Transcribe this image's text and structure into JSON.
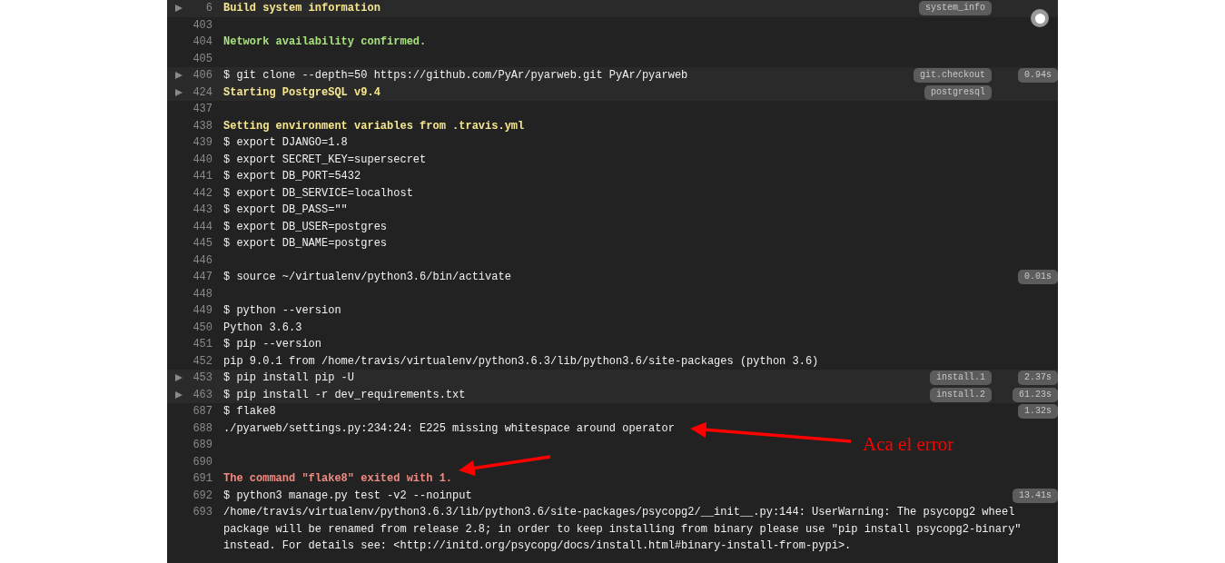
{
  "rows": [
    {
      "kind": "fold",
      "expanded": false,
      "number": "6",
      "text": "Build system information",
      "color": "#f7e78f",
      "tag": "system_info"
    },
    {
      "kind": "line",
      "number": "403"
    },
    {
      "kind": "line",
      "number": "404",
      "text": "Network availability confirmed.",
      "color": "#a8e27c"
    },
    {
      "kind": "line",
      "number": "405"
    },
    {
      "kind": "fold",
      "expanded": false,
      "number": "406",
      "text": "$ git clone --depth=50 https://github.com/PyAr/pyarweb.git PyAr/pyarweb",
      "tag": "git.checkout",
      "time": "0.94s"
    },
    {
      "kind": "fold",
      "expanded": false,
      "number": "424",
      "text": "Starting PostgreSQL v9.4",
      "color": "#f7e78f",
      "tag": "postgresql"
    },
    {
      "kind": "line",
      "number": "437"
    },
    {
      "kind": "line",
      "number": "438",
      "text": "Setting environment variables from .travis.yml",
      "color": "#f7e78f"
    },
    {
      "kind": "line",
      "number": "439",
      "text": "$ export DJANGO=1.8"
    },
    {
      "kind": "line",
      "number": "440",
      "text": "$ export SECRET_KEY=supersecret"
    },
    {
      "kind": "line",
      "number": "441",
      "text": "$ export DB_PORT=5432"
    },
    {
      "kind": "line",
      "number": "442",
      "text": "$ export DB_SERVICE=localhost"
    },
    {
      "kind": "line",
      "number": "443",
      "text": "$ export DB_PASS=\"\""
    },
    {
      "kind": "line",
      "number": "444",
      "text": "$ export DB_USER=postgres"
    },
    {
      "kind": "line",
      "number": "445",
      "text": "$ export DB_NAME=postgres"
    },
    {
      "kind": "line",
      "number": "446"
    },
    {
      "kind": "line",
      "number": "447",
      "text": "$ source ~/virtualenv/python3.6/bin/activate",
      "time": "0.01s"
    },
    {
      "kind": "line",
      "number": "448"
    },
    {
      "kind": "line",
      "number": "449",
      "text": "$ python --version"
    },
    {
      "kind": "line",
      "number": "450",
      "text": "Python 3.6.3"
    },
    {
      "kind": "line",
      "number": "451",
      "text": "$ pip --version"
    },
    {
      "kind": "line",
      "number": "452",
      "text": "pip 9.0.1 from /home/travis/virtualenv/python3.6.3/lib/python3.6/site-packages (python 3.6)"
    },
    {
      "kind": "fold",
      "expanded": false,
      "number": "453",
      "text": "$ pip install pip -U",
      "tag": "install.1",
      "time": "2.37s"
    },
    {
      "kind": "fold",
      "expanded": false,
      "number": "463",
      "text": "$ pip install -r dev_requirements.txt",
      "tag": "install.2",
      "time": "61.23s"
    },
    {
      "kind": "line",
      "number": "687",
      "text": "$ flake8",
      "time": "1.32s"
    },
    {
      "kind": "line",
      "number": "688",
      "text": "./pyarweb/settings.py:234:24: E225 missing whitespace around operator"
    },
    {
      "kind": "line",
      "number": "689"
    },
    {
      "kind": "line",
      "number": "690"
    },
    {
      "kind": "line",
      "number": "691",
      "text": "The command \"flake8\" exited with 1.",
      "color": "#f28b82"
    },
    {
      "kind": "line",
      "number": "692",
      "text": "$ python3 manage.py test -v2 --noinput",
      "time": "13.41s"
    },
    {
      "kind": "line",
      "number": "693",
      "text": "/home/travis/virtualenv/python3.6.3/lib/python3.6/site-packages/psycopg2/__init__.py:144: UserWarning: The psycopg2 wheel package will be renamed from release 2.8; in order to keep installing from binary please use \"pip install psycopg2-binary\" instead. For details see: <http://initd.org/psycopg/docs/install.html#binary-install-from-pypi>."
    }
  ],
  "annotation": {
    "text": "Aca el error"
  }
}
